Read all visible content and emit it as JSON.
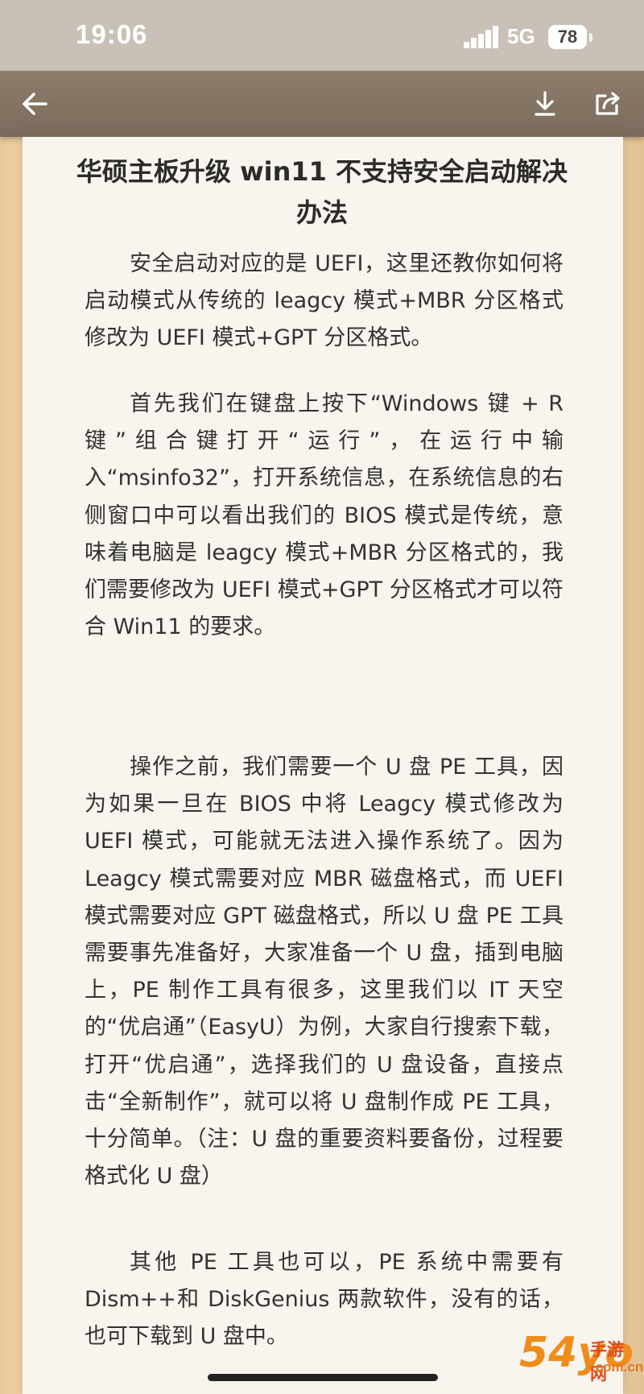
{
  "status_bar": {
    "time": "19:06",
    "network": "5G",
    "battery": "78"
  },
  "toolbar": {
    "back_icon": "arrow-left",
    "download_icon": "download",
    "share_icon": "share-box"
  },
  "article": {
    "title": "华硕主板升级 win11 不支持安全启动解决办法",
    "paragraphs": [
      "安全启动对应的是 UEFI，这里还教你如何将启动模式从传统的 leagcy 模式+MBR 分区格式修改为 UEFI 模式+GPT 分区格式。",
      "首先我们在键盘上按下“Windows 键 + R 键”组合键打开“运行”，在运行中输入“msinfo32”，打开系统信息，在系统信息的右侧窗口中可以看出我们的 BIOS 模式是传统，意味着电脑是 leagcy 模式+MBR 分区格式的，我们需要修改为 UEFI 模式+GPT 分区格式才可以符合 Win11 的要求。",
      "操作之前，我们需要一个 U 盘 PE 工具，因为如果一旦在 BIOS 中将 Leagcy 模式修改为 UEFI 模式，可能就无法进入操作系统了。因为 Leagcy 模式需要对应 MBR 磁盘格式，而 UEFI 模式需要对应 GPT 磁盘格式，所以 U 盘 PE 工具需要事先准备好，大家准备一个 U 盘，插到电脑上，PE 制作工具有很多，这里我们以 IT 天空的“优启通”（EasyU）为例，大家自行搜索下载，打开“优启通”，选择我们的 U 盘设备，直接点击“全新制作”，就可以将 U 盘制作成 PE 工具，十分简单。（注：U 盘的重要资料要备份，过程要格式化 U 盘）",
      "其他 PE 工具也可以，PE 系统中需要有 Dism++和 DiskGenius 两款软件，没有的话，也可下载到 U 盘中。"
    ]
  },
  "watermark": {
    "main": "54yo",
    "line1": "手游网",
    "line2": ".com.cn"
  }
}
